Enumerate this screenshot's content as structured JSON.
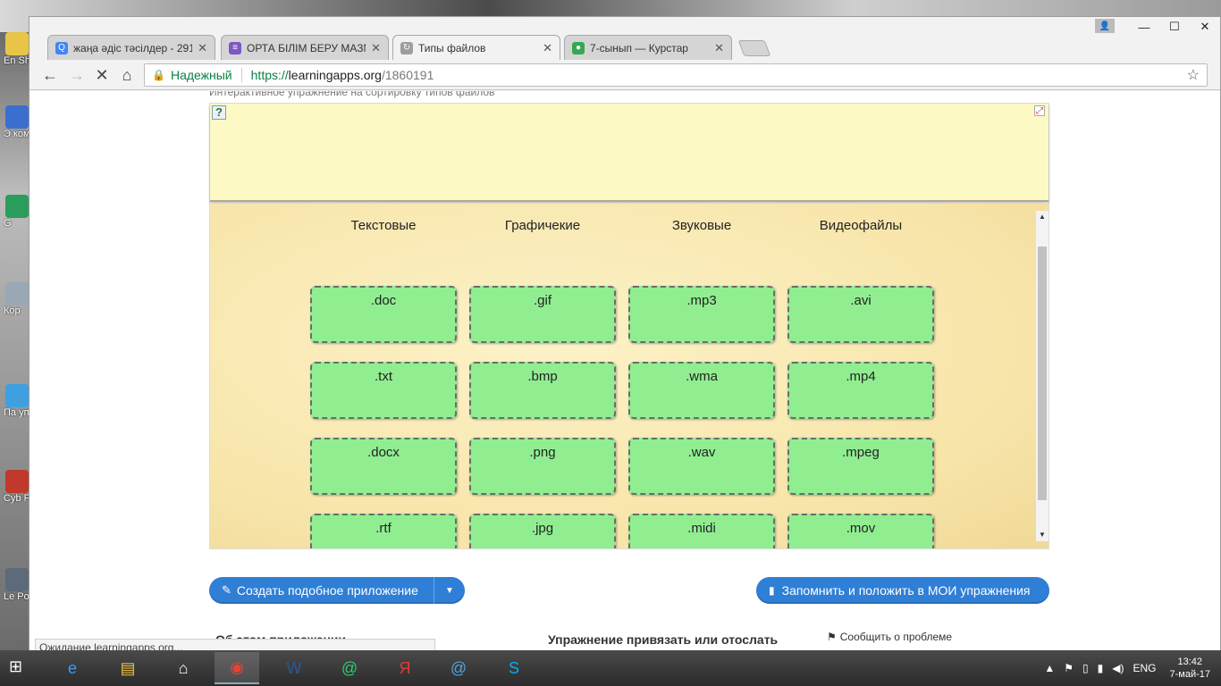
{
  "desktop": {
    "icons": [
      {
        "label": "En Sha",
        "color": "#e8c547"
      },
      {
        "label": "Э комп",
        "color": "#3a6fd0"
      },
      {
        "label": "G",
        "color": "#2a9d5a"
      },
      {
        "label": "Кор",
        "color": "#9aa7b5"
      },
      {
        "label": "Па упра",
        "color": "#3fa0e0"
      },
      {
        "label": "Cyb Pow",
        "color": "#c0392b"
      },
      {
        "label": "Le Powe",
        "color": "#5c6a7a"
      }
    ]
  },
  "window": {
    "minimize": "—",
    "maximize": "☐",
    "close": "✕",
    "user_icon": "person-icon"
  },
  "tabs": [
    {
      "label": "жаңа әдіс тәсілдер - 291",
      "fav": "Q",
      "fav_color": "#4285f4",
      "active": false
    },
    {
      "label": "ОРТА БІЛІМ БЕРУ МАЗМ",
      "fav": "≡",
      "fav_color": "#7e57c2",
      "active": false
    },
    {
      "label": "Типы файлов",
      "fav": "↻",
      "fav_color": "#9e9e9e",
      "active": true
    },
    {
      "label": "7-сынып — Курстар",
      "fav": "●",
      "fav_color": "#34a853",
      "active": false
    }
  ],
  "toolbar": {
    "back": "←",
    "forward": "→",
    "stop": "✕",
    "home": "⌂",
    "secure_label": "Надежный",
    "url_proto": "https://",
    "url_host": "learningapps.org",
    "url_path": "/1860191",
    "bookmark_star": "☆"
  },
  "page": {
    "clipped_text": "Интерактивное упражнение на сортировку типов файлов",
    "columns": [
      "Текстовые",
      "Графичекие",
      "Звуковые",
      "Видеофайлы"
    ],
    "cards": [
      [
        ".doc",
        ".gif",
        ".mp3",
        ".avi"
      ],
      [
        ".txt",
        ".bmp",
        ".wma",
        ".mp4"
      ],
      [
        ".docx",
        ".png",
        ".wav",
        ".mpeg"
      ],
      [
        ".rtf",
        ".jpg",
        ".midi",
        ".mov"
      ]
    ],
    "create_button": "Создать подобное приложение",
    "save_button": "Запомнить и положить в МОИ упражнения",
    "about_title": "Об этом приложении",
    "bind_title": "Упражнение привязать или отослать",
    "report_link": "Сообщить о проблеме"
  },
  "status_bar": "Ожидание learningapps.org...",
  "taskbar": {
    "apps": [
      {
        "name": "ie-icon",
        "glyph": "e",
        "color": "#3d9be9"
      },
      {
        "name": "explorer-icon",
        "glyph": "▤",
        "color": "#f0c040"
      },
      {
        "name": "home-icon",
        "glyph": "⌂",
        "color": "#ffffff"
      },
      {
        "name": "chrome-icon",
        "glyph": "◉",
        "color": "#e94235"
      },
      {
        "name": "word-icon",
        "glyph": "W",
        "color": "#2b579a"
      },
      {
        "name": "mail-agent-icon",
        "glyph": "@",
        "color": "#2ecc71"
      },
      {
        "name": "yandex-icon",
        "glyph": "Я",
        "color": "#e53935"
      },
      {
        "name": "mail-icon",
        "glyph": "@",
        "color": "#4fa3e0"
      },
      {
        "name": "skype-icon",
        "glyph": "S",
        "color": "#00aff0"
      }
    ],
    "lang": "ENG",
    "time": "13:42",
    "date": "7-май-17"
  }
}
